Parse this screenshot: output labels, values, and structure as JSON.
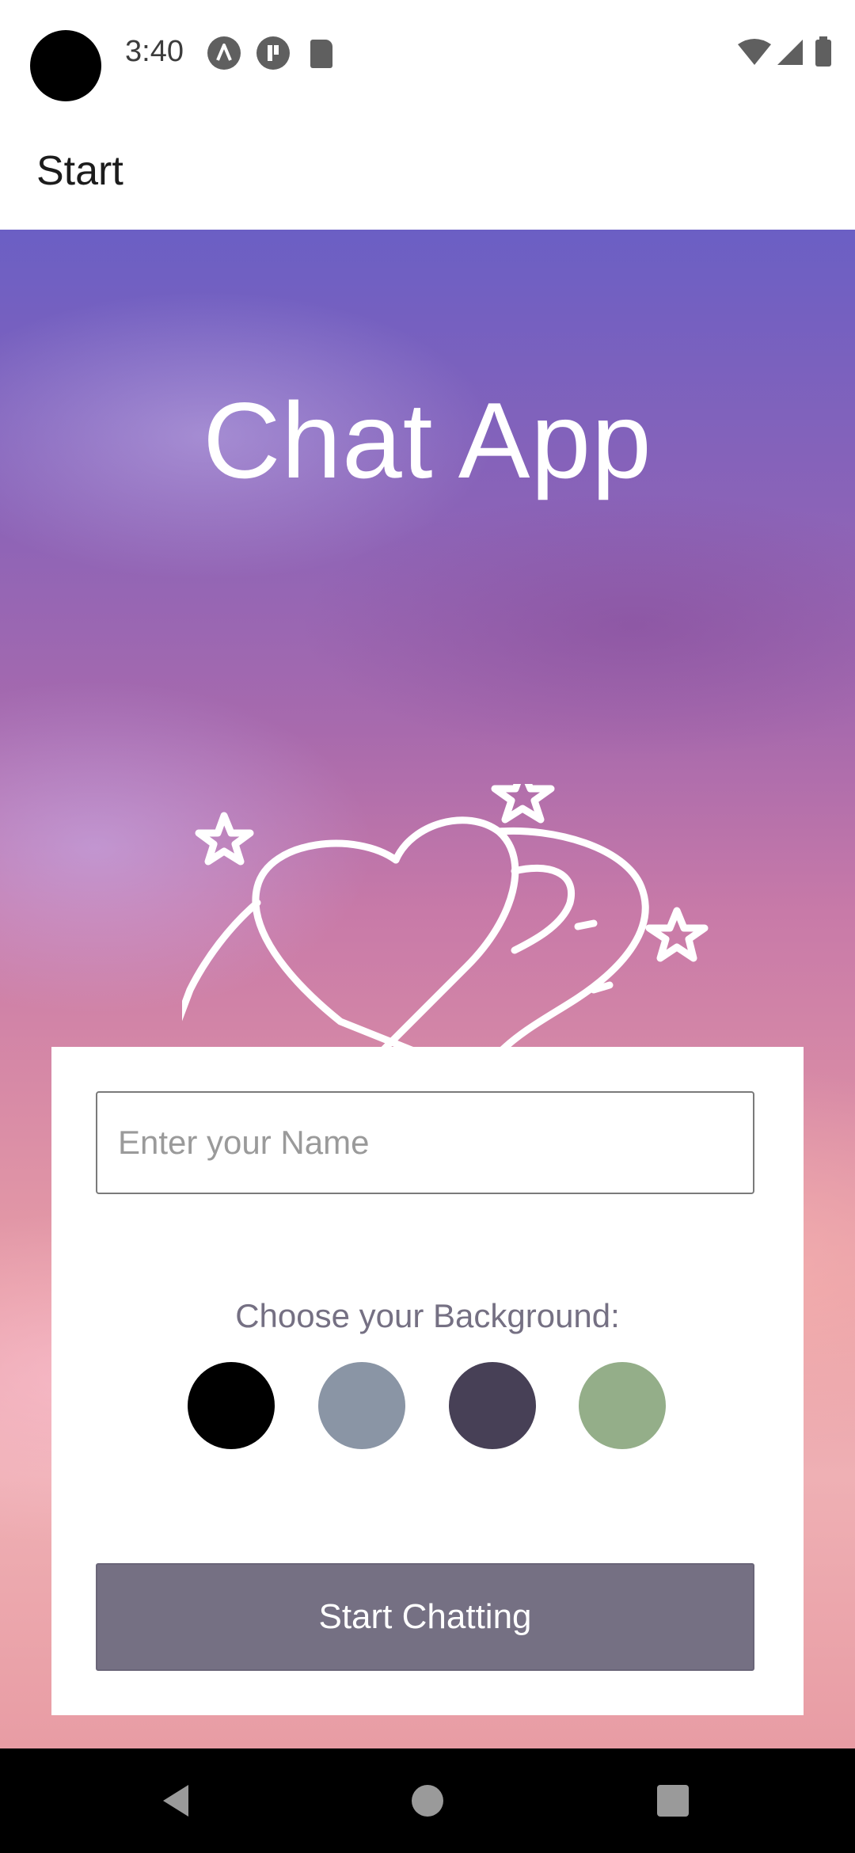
{
  "status_bar": {
    "time": "3:40",
    "icons": [
      "camera-dot",
      "a-notification-icon",
      "p-notification-icon",
      "sd-card-icon",
      "wifi-icon",
      "signal-icon",
      "battery-icon"
    ]
  },
  "app_bar": {
    "title": "Start"
  },
  "main": {
    "app_title": "Chat App",
    "name_input": {
      "placeholder": "Enter your Name",
      "value": ""
    },
    "background_label": "Choose your Background:",
    "background_colors": [
      "#000000",
      "#8A95A5",
      "#474056",
      "#94AE89"
    ],
    "start_button_label": "Start Chatting"
  },
  "colors": {
    "button": "#757083",
    "label_text": "#757083"
  },
  "nav_bar": {
    "buttons": [
      "back",
      "home",
      "recents"
    ]
  }
}
